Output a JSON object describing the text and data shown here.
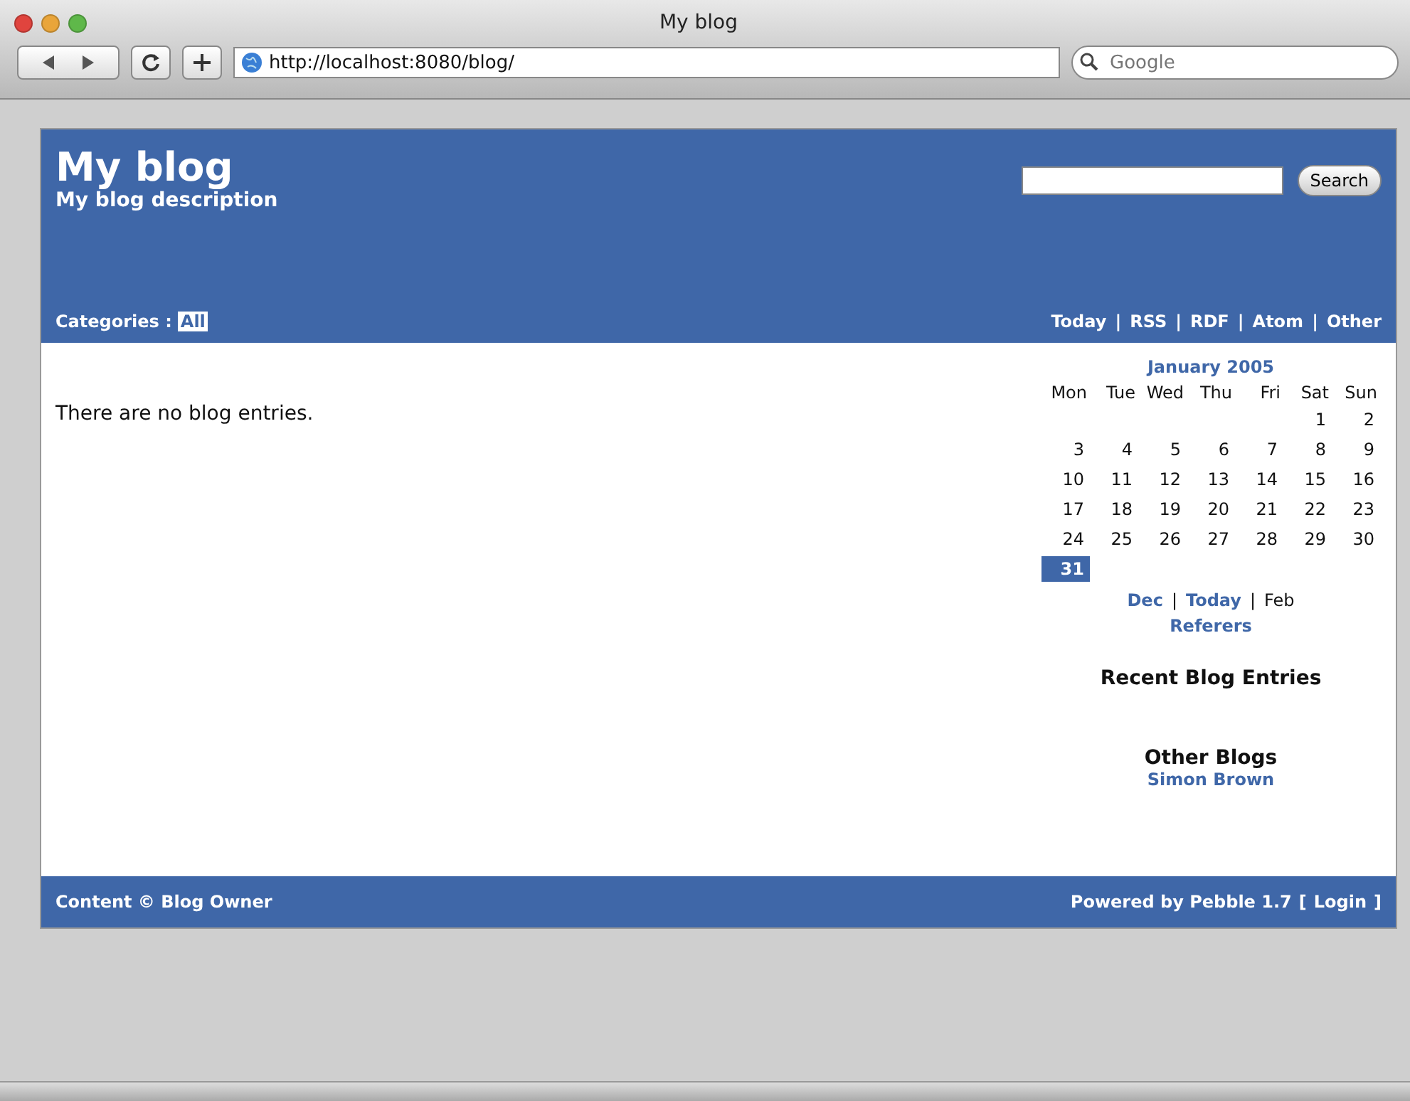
{
  "window": {
    "title": "My blog"
  },
  "toolbar": {
    "address": "http://localhost:8080/blog/",
    "search_placeholder": "Google"
  },
  "header": {
    "title": "My blog",
    "description": "My blog description",
    "search_button": "Search",
    "categories_label": "Categories :",
    "categories": [
      {
        "label": "All",
        "selected": true
      }
    ],
    "feeds": [
      "Today",
      "RSS",
      "RDF",
      "Atom",
      "Other"
    ],
    "feed_separator": "|"
  },
  "content": {
    "message": "There are no blog entries."
  },
  "calendar": {
    "title": "January 2005",
    "weekdays": [
      "Mon",
      "Tue",
      "Wed",
      "Thu",
      "Fri",
      "Sat",
      "Sun"
    ],
    "weeks": [
      [
        {
          "day": "1",
          "selected": false
        },
        {
          "day": "2",
          "selected": false
        }
      ],
      [
        {
          "day": "3",
          "selected": false
        },
        {
          "day": "4",
          "selected": false
        },
        {
          "day": "5",
          "selected": false
        },
        {
          "day": "6",
          "selected": false
        },
        {
          "day": "7",
          "selected": false
        },
        {
          "day": "8",
          "selected": false
        },
        {
          "day": "9",
          "selected": false
        }
      ],
      [
        {
          "day": "10",
          "selected": false
        },
        {
          "day": "11",
          "selected": false
        },
        {
          "day": "12",
          "selected": false
        },
        {
          "day": "13",
          "selected": false
        },
        {
          "day": "14",
          "selected": false
        },
        {
          "day": "15",
          "selected": false
        },
        {
          "day": "16",
          "selected": false
        }
      ],
      [
        {
          "day": "17",
          "selected": false
        },
        {
          "day": "18",
          "selected": false
        },
        {
          "day": "19",
          "selected": false
        },
        {
          "day": "20",
          "selected": false
        },
        {
          "day": "21",
          "selected": false
        },
        {
          "day": "22",
          "selected": false
        },
        {
          "day": "23",
          "selected": false
        }
      ],
      [
        {
          "day": "24",
          "selected": false
        },
        {
          "day": "25",
          "selected": false
        },
        {
          "day": "26",
          "selected": false
        },
        {
          "day": "27",
          "selected": false
        },
        {
          "day": "28",
          "selected": false
        },
        {
          "day": "29",
          "selected": false
        },
        {
          "day": "30",
          "selected": false
        }
      ],
      [
        {
          "day": "31",
          "selected": true
        }
      ]
    ],
    "nav": [
      {
        "label": "Dec",
        "kind": "link"
      },
      {
        "label": "Today",
        "kind": "link"
      },
      {
        "label": "Feb",
        "kind": "text"
      }
    ],
    "nav_separator": "|",
    "referers": "Referers"
  },
  "sidebar": {
    "recent_title": "Recent Blog Entries",
    "other_title": "Other Blogs",
    "other_blogs": [
      "Simon Brown"
    ]
  },
  "footer": {
    "left": "Content © Blog Owner",
    "powered": "Powered by Pebble 1.7",
    "login_open": "[",
    "login": "Login",
    "login_close": "]"
  }
}
